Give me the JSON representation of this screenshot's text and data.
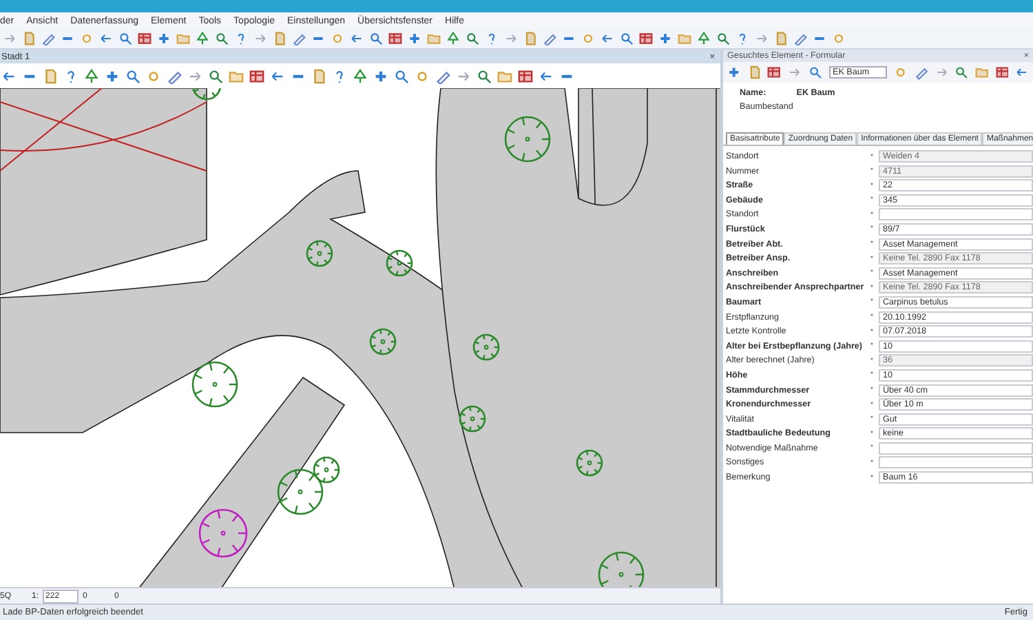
{
  "menu": [
    "der",
    "Ansicht",
    "Datenerfassung",
    "Element",
    "Tools",
    "Topologie",
    "Einstellungen",
    "Übersichtsfenster",
    "Hilfe"
  ],
  "document": {
    "title": "Stadt 1",
    "close": "×"
  },
  "map_status": {
    "scale_label": "1:",
    "scale": "222",
    "field_1": "0",
    "field_2": "0",
    "field_0": "5Q"
  },
  "panel": {
    "title": "Gesuchtes Element - Formular",
    "close": "×",
    "layer": "EK Baum",
    "name_label": "Name:",
    "name_value": "EK Baum",
    "subtitle": "Baumbestand",
    "tabs": [
      {
        "label": "Basisattribute",
        "selected": true
      },
      {
        "label": "Zuordnung Daten",
        "selected": false
      },
      {
        "label": "Informationen über das Element",
        "selected": false
      },
      {
        "label": "Maßnahmen",
        "selected": false
      }
    ],
    "fields": [
      {
        "label": "Standort",
        "required": false,
        "marker": "*",
        "value": "Weiden 4",
        "disabled": true
      },
      {
        "label": "Nummer",
        "required": false,
        "marker": "*",
        "value": "4711",
        "disabled": true
      },
      {
        "label": "Straße",
        "required": true,
        "marker": "*",
        "value": "22",
        "disabled": false
      },
      {
        "label": "Gebäude",
        "required": true,
        "marker": "*",
        "value": "345",
        "disabled": false
      },
      {
        "label": "Standort",
        "required": false,
        "marker": "*",
        "disabled": false
      },
      {
        "label": "Flurstück",
        "required": true,
        "marker": "*",
        "value": "89/7",
        "disabled": false
      },
      {
        "label": "Betreiber Abt.",
        "required": true,
        "marker": "*",
        "value": "Asset Management",
        "disabled": false
      },
      {
        "label": "Betreiber Ansp.",
        "required": true,
        "marker": "*",
        "value": "Keine Tel. 2890 Fax 1178",
        "disabled": true
      },
      {
        "label": "Anschreiben",
        "required": true,
        "marker": "*",
        "value": "Asset Management",
        "disabled": false
      },
      {
        "label": "Anschreibender Ansprechpartner",
        "required": true,
        "marker": "*",
        "value": "Keine Tel. 2890 Fax 1178",
        "disabled": true
      },
      {
        "label": "Baumart",
        "required": true,
        "marker": "*",
        "value": "Carpinus betulus",
        "disabled": false
      },
      {
        "label": "Erstpflanzung",
        "required": false,
        "marker": "*",
        "value": "20.10.1992",
        "disabled": false
      },
      {
        "label": "Letzte Kontrolle",
        "required": false,
        "marker": "*",
        "value": "07.07.2018",
        "disabled": false
      },
      {
        "label": "Alter bei Erstbepflanzung (Jahre)",
        "required": true,
        "marker": "*",
        "value": "10",
        "disabled": false
      },
      {
        "label": "Alter berechnet (Jahre)",
        "required": false,
        "marker": "*",
        "value": "36",
        "disabled": true
      },
      {
        "label": "Höhe",
        "required": true,
        "marker": "*",
        "value": "10",
        "disabled": false
      },
      {
        "label": "Stammdurchmesser",
        "required": true,
        "marker": "*",
        "value": "Über 40 cm",
        "disabled": false
      },
      {
        "label": "Kronendurchmesser",
        "required": true,
        "marker": "*",
        "value": "Über 10 m",
        "disabled": false
      },
      {
        "label": "Vitalität",
        "required": false,
        "marker": "*",
        "value": "Gut",
        "disabled": false
      },
      {
        "label": "Stadtbauliche Bedeutung",
        "required": true,
        "marker": "*",
        "value": "keine",
        "disabled": false
      },
      {
        "label": "Notwendige Maßnahme",
        "required": false,
        "marker": "*",
        "disabled": false
      },
      {
        "label": "Sonstiges",
        "required": false,
        "marker": "*",
        "disabled": false
      },
      {
        "label": "Bemerkung",
        "required": false,
        "marker": "*",
        "value": "Baum 16",
        "disabled": false
      }
    ]
  },
  "status_bar": {
    "message": "Lade BP-Daten erfolgreich beendet",
    "state": "Fertig"
  }
}
